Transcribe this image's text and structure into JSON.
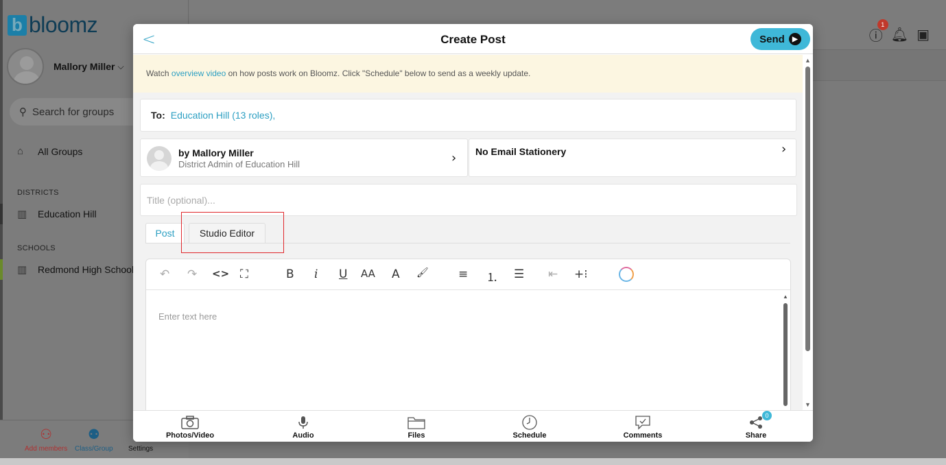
{
  "app": {
    "logo_letter": "b",
    "logo_text": "bloomz",
    "user_name": "Mallory Miller",
    "search_placeholder": "Search for groups",
    "all_groups": "All Groups",
    "districts_heading": "DISTRICTS",
    "district_item": "Education Hill",
    "schools_heading": "SCHOOLS",
    "school_item": "Redmond High School",
    "help_badge": "1",
    "bottom": {
      "add_members": "Add members",
      "class_group": "Class/Group",
      "settings": "Settings"
    }
  },
  "modal": {
    "title": "Create Post",
    "send_label": "Send",
    "banner": {
      "prefix": "Watch ",
      "link": "overview video",
      "suffix": " on how posts work on Bloomz. Click \"Schedule\" below to send as a weekly update."
    },
    "to_label": "To:",
    "to_value": "Education Hill (13 roles),",
    "author_name": "by Mallory Miller",
    "author_role": "District Admin of Education Hill",
    "stationery": "No Email Stationery",
    "title_placeholder": "Title (optional)...",
    "tabs": [
      {
        "label": "Post"
      },
      {
        "label": "Studio Editor"
      }
    ],
    "editor_placeholder": "Enter text here",
    "toolbar": {
      "undo": "↶",
      "redo": "↷",
      "code": "<>",
      "fullscreen": "⛶",
      "bold": "B",
      "italic": "i",
      "underline": "U",
      "font_size": "AA",
      "font_color": "A",
      "highlight": "🖌",
      "align": "≡",
      "ordered_list": "⒈",
      "unordered_list": "☰",
      "outdent": "⇤",
      "insert": "+⁝"
    },
    "footer": [
      {
        "label": "Photos/Video",
        "icon": "camera-icon"
      },
      {
        "label": "Audio",
        "icon": "microphone-icon"
      },
      {
        "label": "Files",
        "icon": "folder-icon"
      },
      {
        "label": "Schedule",
        "icon": "clock-icon"
      },
      {
        "label": "Comments",
        "icon": "comment-icon"
      },
      {
        "label": "Share",
        "icon": "share-icon"
      }
    ],
    "share_count": "0"
  },
  "colors": {
    "accent": "#3fb8d8",
    "link": "#2c9fc2",
    "banner_bg": "#fcf6e1",
    "highlight_box": "#e0262a"
  }
}
